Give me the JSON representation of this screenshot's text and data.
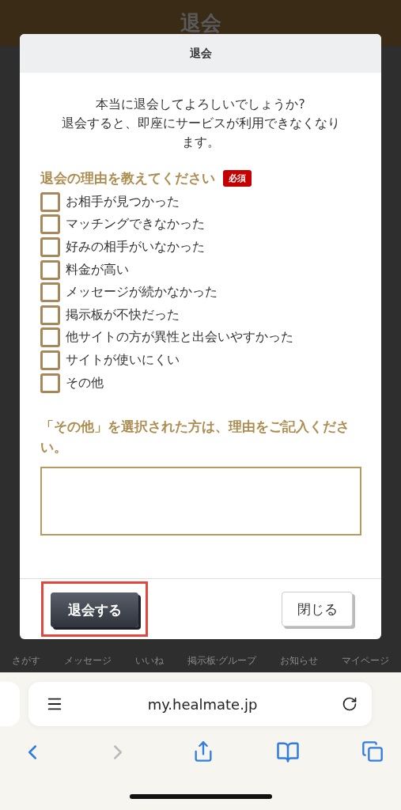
{
  "page": {
    "title": "退会"
  },
  "dialog": {
    "title": "退会",
    "message": "本当に退会してよろしいでしょうか?\n退会すると、即座にサービスが利用できなくなります。",
    "reasons_label": "退会の理由を教えてください",
    "required_badge": "必須",
    "reasons": [
      {
        "label": "お相手が見つかった",
        "checked": false
      },
      {
        "label": "マッチングできなかった",
        "checked": false
      },
      {
        "label": "好みの相手がいなかった",
        "checked": false
      },
      {
        "label": "料金が高い",
        "checked": false
      },
      {
        "label": "メッセージが続かなかった",
        "checked": false
      },
      {
        "label": "掲示板が不快だった",
        "checked": false
      },
      {
        "label": "他サイトの方が異性と出会いやすかった",
        "checked": false
      },
      {
        "label": "サイトが使いにくい",
        "checked": false
      },
      {
        "label": "その他",
        "checked": false
      }
    ],
    "other_label": "「その他」を選択された方は、理由をご記入ください。",
    "buttons": [
      {
        "label": "退会する",
        "kind": "primary",
        "highlighted": true
      },
      {
        "label": "閉じる",
        "kind": "secondary",
        "highlighted": false
      }
    ]
  },
  "bottom_nav": [
    "さがす",
    "メッセージ",
    "いいね",
    "掲示板·グループ",
    "お知らせ",
    "マイページ"
  ],
  "browser": {
    "url": "my.healmate.jp"
  }
}
